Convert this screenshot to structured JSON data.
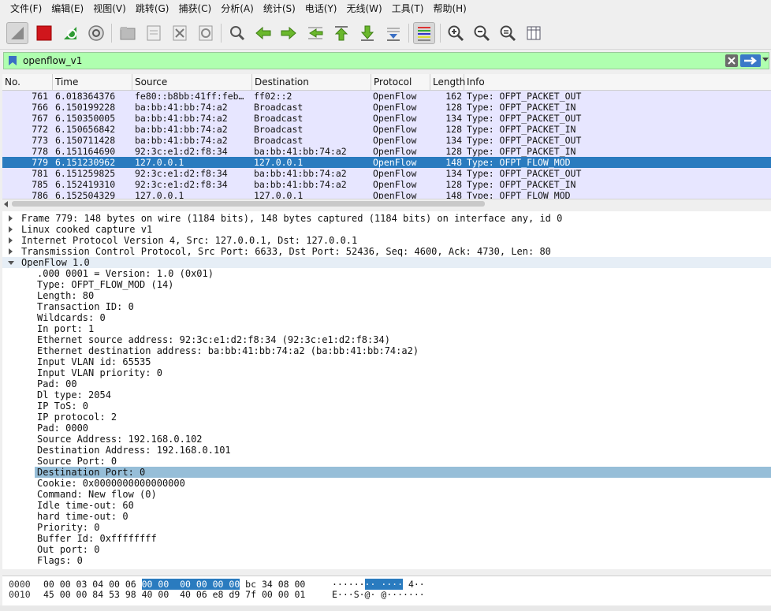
{
  "menu": [
    "文件(F)",
    "编辑(E)",
    "视图(V)",
    "跳转(G)",
    "捕获(C)",
    "分析(A)",
    "统计(S)",
    "电话(Y)",
    "无线(W)",
    "工具(T)",
    "帮助(H)"
  ],
  "filter": {
    "value": "openflow_v1",
    "background": "#afffaf"
  },
  "columns": [
    "No.",
    "Time",
    "Source",
    "Destination",
    "Protocol",
    "Length",
    "Info"
  ],
  "packets": [
    {
      "no": "761",
      "time": "6.018364376",
      "src": "fe80::b8bb:41ff:feb…",
      "dst": "ff02::2",
      "proto": "OpenFlow",
      "len": "162",
      "info": "Type: OFPT_PACKET_OUT"
    },
    {
      "no": "766",
      "time": "6.150199228",
      "src": "ba:bb:41:bb:74:a2",
      "dst": "Broadcast",
      "proto": "OpenFlow",
      "len": "128",
      "info": "Type: OFPT_PACKET_IN"
    },
    {
      "no": "767",
      "time": "6.150350005",
      "src": "ba:bb:41:bb:74:a2",
      "dst": "Broadcast",
      "proto": "OpenFlow",
      "len": "134",
      "info": "Type: OFPT_PACKET_OUT"
    },
    {
      "no": "772",
      "time": "6.150656842",
      "src": "ba:bb:41:bb:74:a2",
      "dst": "Broadcast",
      "proto": "OpenFlow",
      "len": "128",
      "info": "Type: OFPT_PACKET_IN"
    },
    {
      "no": "773",
      "time": "6.150711428",
      "src": "ba:bb:41:bb:74:a2",
      "dst": "Broadcast",
      "proto": "OpenFlow",
      "len": "134",
      "info": "Type: OFPT_PACKET_OUT"
    },
    {
      "no": "778",
      "time": "6.151164690",
      "src": "92:3c:e1:d2:f8:34",
      "dst": "ba:bb:41:bb:74:a2",
      "proto": "OpenFlow",
      "len": "128",
      "info": "Type: OFPT_PACKET_IN"
    },
    {
      "no": "779",
      "time": "6.151230962",
      "src": "127.0.0.1",
      "dst": "127.0.0.1",
      "proto": "OpenFlow",
      "len": "148",
      "info": "Type: OFPT_FLOW_MOD",
      "selected": true
    },
    {
      "no": "781",
      "time": "6.151259825",
      "src": "92:3c:e1:d2:f8:34",
      "dst": "ba:bb:41:bb:74:a2",
      "proto": "OpenFlow",
      "len": "134",
      "info": "Type: OFPT_PACKET_OUT"
    },
    {
      "no": "785",
      "time": "6.152419310",
      "src": "92:3c:e1:d2:f8:34",
      "dst": "ba:bb:41:bb:74:a2",
      "proto": "OpenFlow",
      "len": "128",
      "info": "Type: OFPT_PACKET_IN"
    },
    {
      "no": "786",
      "time": "6.152504329",
      "src": "127.0.0.1",
      "dst": "127.0.0.1",
      "proto": "OpenFlow",
      "len": "148",
      "info": "Type: OFPT_FLOW_MOD"
    }
  ],
  "details": {
    "tree": [
      "Frame 779: 148 bytes on wire (1184 bits), 148 bytes captured (1184 bits) on interface any, id 0",
      "Linux cooked capture v1",
      "Internet Protocol Version 4, Src: 127.0.0.1, Dst: 127.0.0.1",
      "Transmission Control Protocol, Src Port: 6633, Dst Port: 52436, Seq: 4600, Ack: 4730, Len: 80",
      "OpenFlow 1.0"
    ],
    "fields": [
      ".000 0001 = Version: 1.0 (0x01)",
      "Type: OFPT_FLOW_MOD (14)",
      "Length: 80",
      "Transaction ID: 0",
      "Wildcards: 0",
      "In port: 1",
      "Ethernet source address: 92:3c:e1:d2:f8:34 (92:3c:e1:d2:f8:34)",
      "Ethernet destination address: ba:bb:41:bb:74:a2 (ba:bb:41:bb:74:a2)",
      "Input VLAN id: 65535",
      "Input VLAN priority: 0",
      "Pad: 00",
      "Dl type: 2054",
      "IP ToS: 0",
      "IP protocol: 2",
      "Pad: 0000",
      "Source Address: 192.168.0.102",
      "Destination Address: 192.168.0.101",
      "Source Port: 0",
      "Destination Port: 0",
      "Cookie: 0x0000000000000000",
      "Command: New flow (0)",
      "Idle time-out: 60",
      "hard time-out: 0",
      "Priority: 0",
      "Buffer Id: 0xffffffff",
      "Out port: 0",
      "Flags: 0"
    ],
    "highlighted_field": "Destination Port: 0"
  },
  "bytes": [
    {
      "offset": "0000",
      "hex_pre": "00 00 03 04 00 06 ",
      "hex_hl": "00 00  00 00 00 00",
      "hex_post": " bc 34 08 00",
      "ascii_pre": "······",
      "ascii_hl": "·· ····",
      "ascii_post": " 4··"
    },
    {
      "offset": "0010",
      "hex_pre": "45 00 00 84 53 98 40 00  40 06 e8 d9 7f 00 00 01",
      "hex_hl": "",
      "hex_post": "",
      "ascii_pre": "E···S·@· @·······",
      "ascii_hl": "",
      "ascii_post": ""
    }
  ],
  "colors": {
    "row_bg": "#e7e6ff",
    "selected_row": "#2a7bbf",
    "highlight_field": "#96bed8"
  }
}
